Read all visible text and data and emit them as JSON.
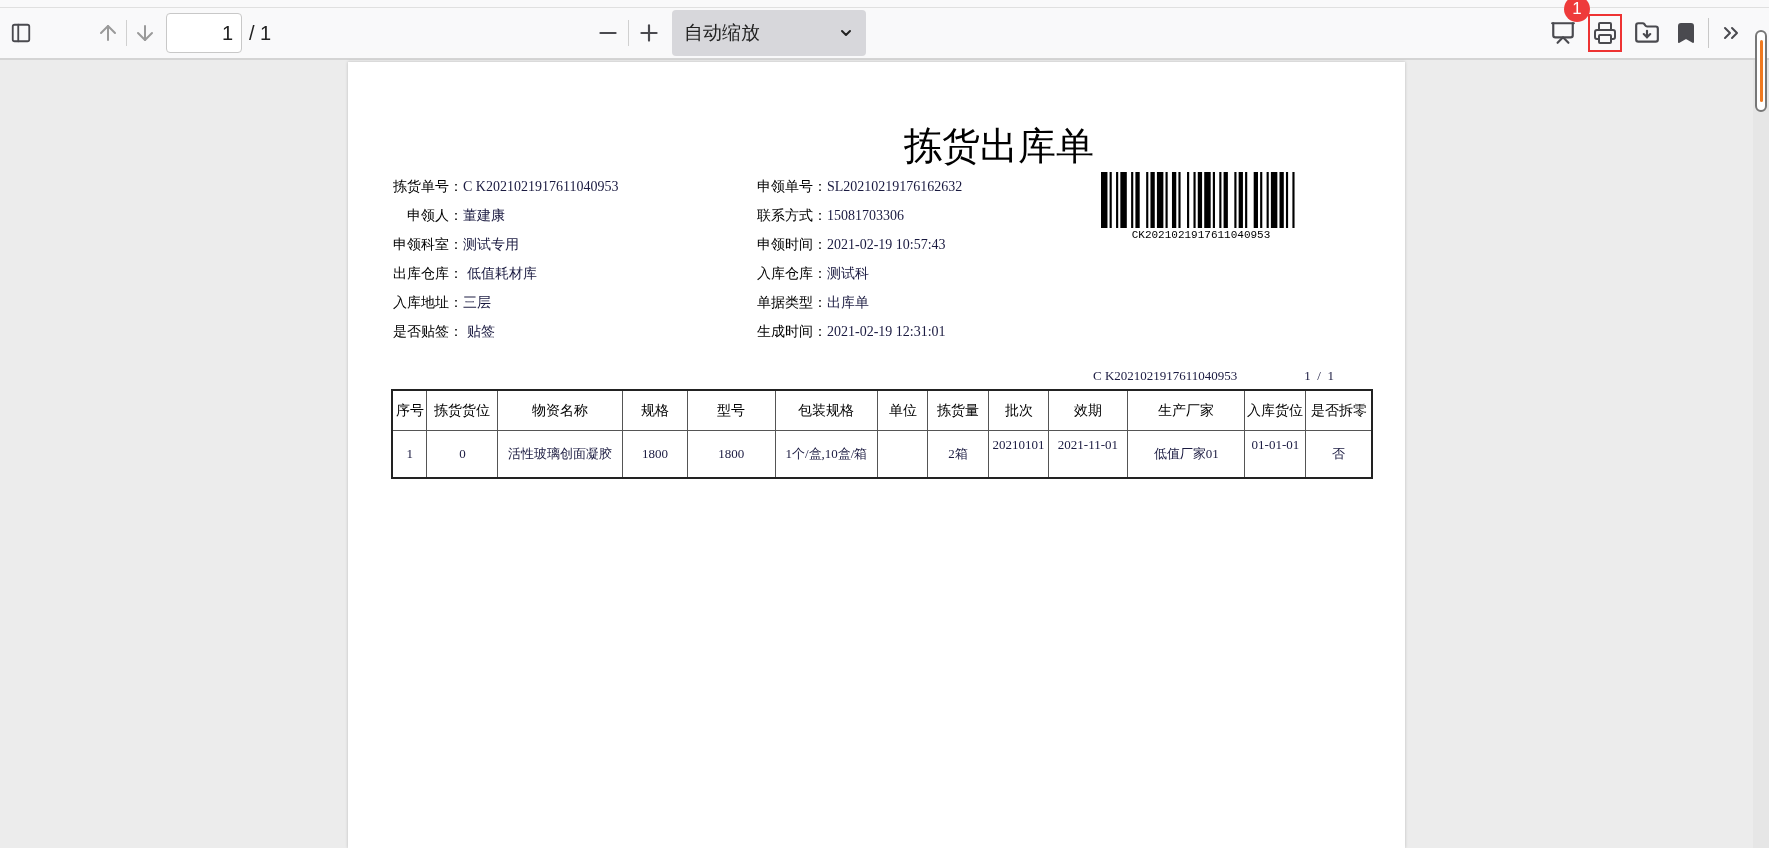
{
  "toolbar": {
    "page_number": "1",
    "page_count": "/ 1",
    "zoom": "自动缩放",
    "badge": "1"
  },
  "document": {
    "title": "拣货出库单",
    "fields_left": [
      {
        "label": "拣货单号：",
        "value": "C K2021021917611040953"
      },
      {
        "label": "申领人：",
        "value": "董建康"
      },
      {
        "label": "申领科室：",
        "value": "测试专用"
      },
      {
        "label": "出库仓库：",
        "value": " 低值耗材库"
      },
      {
        "label": "入库地址：",
        "value": "三层"
      },
      {
        "label": "是否贴签：",
        "value": " 贴签"
      }
    ],
    "fields_right": [
      {
        "label": "申领单号：",
        "value": "SL20210219176162632"
      },
      {
        "label": "联系方式：",
        "value": "15081703306"
      },
      {
        "label": "申领时间：",
        "value": "2021-02-19 10:57:43"
      },
      {
        "label": "入库仓库：",
        "value": "测试科"
      },
      {
        "label": "单据类型：",
        "value": "出库单"
      },
      {
        "label": "生成时间：",
        "value": "2021-02-19 12:31:01"
      }
    ],
    "barcode_text": "CK2021021917611040953",
    "doc_number": "C K2021021917611040953",
    "page_indicator": "1  /  1",
    "table": {
      "columns": [
        "序号",
        "拣货货位",
        "物资名称",
        "规格",
        "型号",
        "包装规格",
        "单位",
        "拣货量",
        "批次",
        "效期",
        "生产厂家",
        "入库货位",
        "是否拆零"
      ],
      "rows": [
        [
          "1",
          "0",
          "活性玻璃创面凝胶",
          "1800",
          "1800",
          "1个/盒,10盒/箱",
          "",
          "2箱",
          "20210101",
          "2021-11-01",
          "低值厂家01",
          "01-01-01",
          "否"
        ]
      ]
    }
  }
}
